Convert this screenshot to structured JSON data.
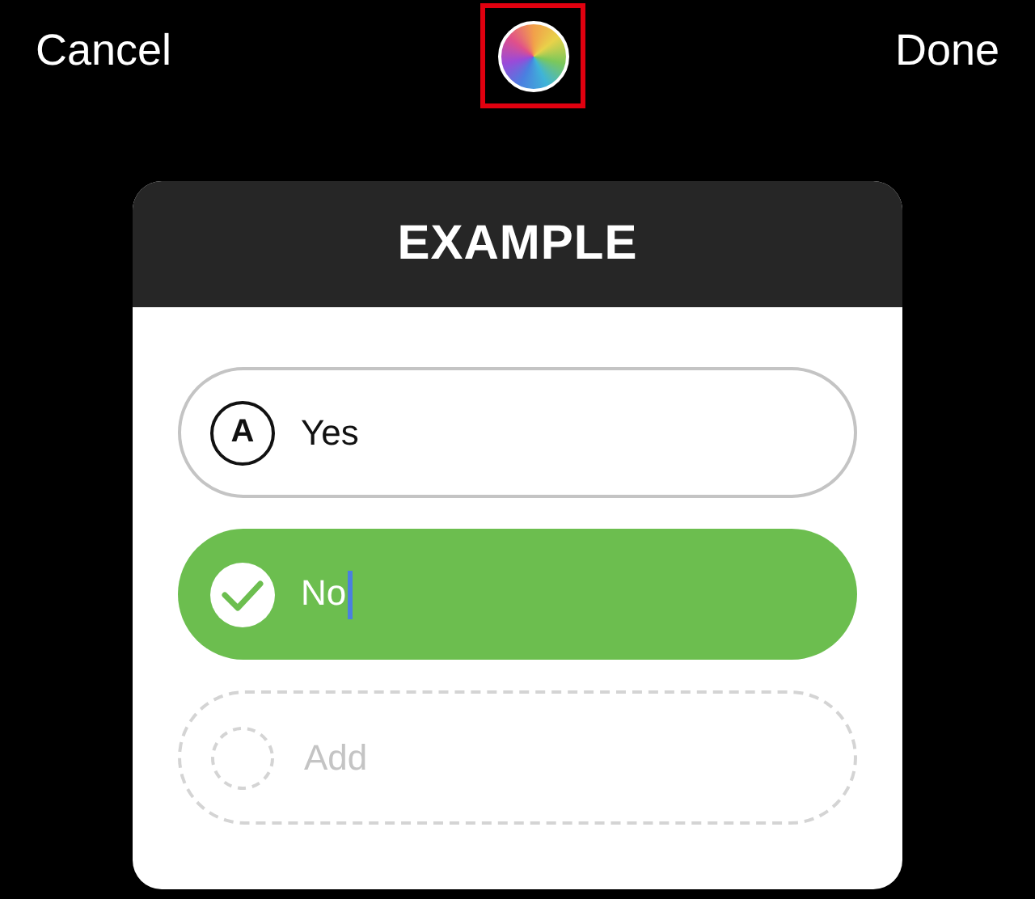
{
  "top_bar": {
    "cancel": "Cancel",
    "done": "Done",
    "color_picker": {
      "highlighted": true
    }
  },
  "quiz": {
    "title": "EXAMPLE",
    "options": [
      {
        "kind": "answer",
        "marker": "A",
        "text": "Yes",
        "selected": false,
        "editing": false
      },
      {
        "kind": "answer",
        "text": "No",
        "selected": true,
        "editing": true
      },
      {
        "kind": "add",
        "placeholder": "Add"
      }
    ]
  }
}
